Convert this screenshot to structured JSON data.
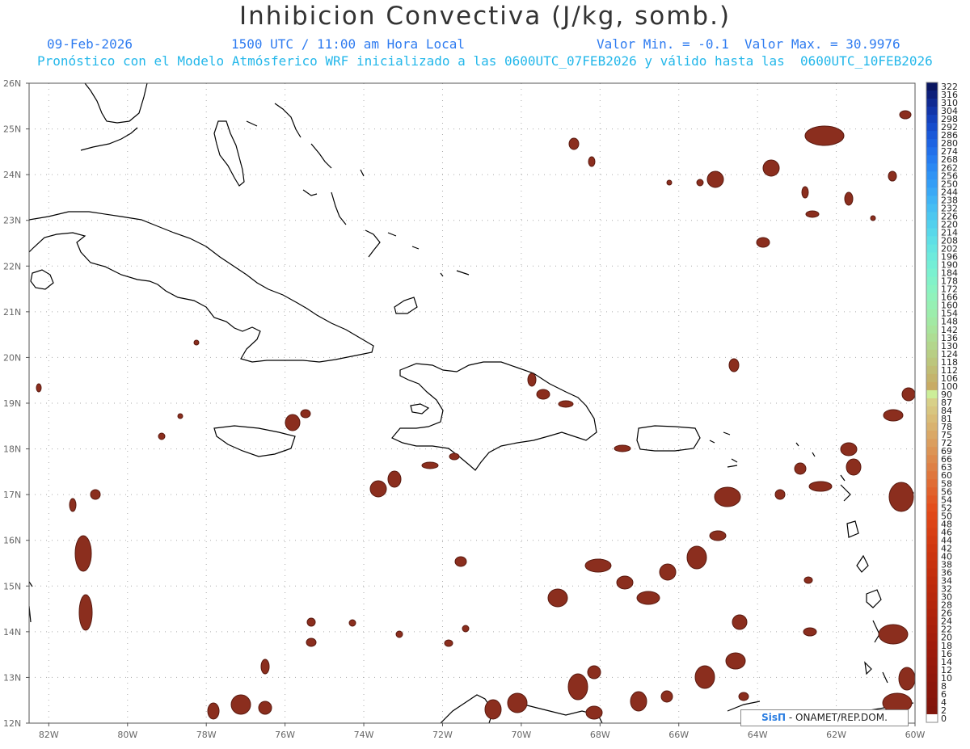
{
  "header": {
    "title": "Inhibicion Convectiva (J/kg, somb.)",
    "date": "09-Feb-2026",
    "time": "1500 UTC / 11:00 am Hora Local",
    "minmax": "Valor Min. = -0.1  Valor Max. = 30.9976",
    "model_line": "Pronóstico con el Modelo Atmósferico WRF inicializado a las 0600UTC_07FEB2026 y válido hasta las  0600UTC_10FEB2026"
  },
  "axes": {
    "lat_labels": [
      "26N",
      "25N",
      "24N",
      "23N",
      "22N",
      "21N",
      "20N",
      "19N",
      "18N",
      "17N",
      "16N",
      "15N",
      "14N",
      "13N",
      "12N"
    ],
    "lon_labels": [
      "82W",
      "80W",
      "78W",
      "76W",
      "74W",
      "72W",
      "70W",
      "68W",
      "66W",
      "64W",
      "62W",
      "60W"
    ],
    "lat_range": [
      12,
      26
    ],
    "lon_range": [
      -82.5,
      -60
    ],
    "grid": "dotted"
  },
  "legend": {
    "values": [
      "322",
      "316",
      "310",
      "304",
      "298",
      "292",
      "286",
      "280",
      "274",
      "268",
      "262",
      "256",
      "250",
      "244",
      "238",
      "232",
      "226",
      "220",
      "214",
      "208",
      "202",
      "196",
      "190",
      "184",
      "178",
      "172",
      "166",
      "160",
      "154",
      "148",
      "142",
      "136",
      "130",
      "124",
      "118",
      "112",
      "106",
      "100",
      "90",
      "87",
      "84",
      "81",
      "78",
      "75",
      "72",
      "69",
      "66",
      "63",
      "60",
      "58",
      "56",
      "54",
      "52",
      "50",
      "48",
      "46",
      "44",
      "42",
      "40",
      "38",
      "36",
      "34",
      "32",
      "30",
      "28",
      "26",
      "24",
      "22",
      "20",
      "18",
      "16",
      "14",
      "12",
      "10",
      "8",
      "6",
      "4",
      "2",
      "0"
    ],
    "colors": [
      "#0a1660",
      "#0d1f7a",
      "#102a91",
      "#1235a8",
      "#1441bc",
      "#164ccc",
      "#1a58d8",
      "#1e64e2",
      "#2270ea",
      "#267cf0",
      "#2a88f3",
      "#2f93f5",
      "#349ef6",
      "#3aa9f6",
      "#40b4f5",
      "#46bef3",
      "#4cc7f0",
      "#52d0ed",
      "#58d8ea",
      "#5fdfe6",
      "#66e5e1",
      "#6deadc",
      "#74eed6",
      "#7bf1d0",
      "#82f2c9",
      "#89f3c2",
      "#90f2bb",
      "#96f0b4",
      "#9cedac",
      "#a2e9a4",
      "#a8e49c",
      "#aedd94",
      "#b3d68c",
      "#b8ce84",
      "#bcc67c",
      "#c0bd74",
      "#c4b46c",
      "#c8ab64",
      "#ccee99",
      "#d8d088",
      "#d8c680",
      "#d9bc77",
      "#d9b26f",
      "#daa866",
      "#db9e5e",
      "#dc9455",
      "#dd8a4d",
      "#de8045",
      "#df763c",
      "#e06c34",
      "#e1622c",
      "#e25824",
      "#e34e1c",
      "#e04818",
      "#dc4416",
      "#d84014",
      "#d43c12",
      "#d03810",
      "#cc350f",
      "#c8320e",
      "#c42f0d",
      "#c02c0c",
      "#bc2a0c",
      "#b8280c",
      "#b4260c",
      "#b0240c",
      "#ac220c",
      "#a8200c",
      "#a41e0c",
      "#a01c0c",
      "#9c1b0c",
      "#981a0c",
      "#94190c",
      "#90180c",
      "#8c170c",
      "#88170c",
      "#84160c",
      "#80160c",
      "#ffffff"
    ]
  },
  "credit": {
    "brand": "SisΠ",
    "text": "- ONAMET/REP.DOM."
  },
  "colors": {
    "shade": "#8b2e1e",
    "shade_edge": "#5a1a10",
    "coast": "#000000",
    "grid": "#aaaaaa"
  }
}
